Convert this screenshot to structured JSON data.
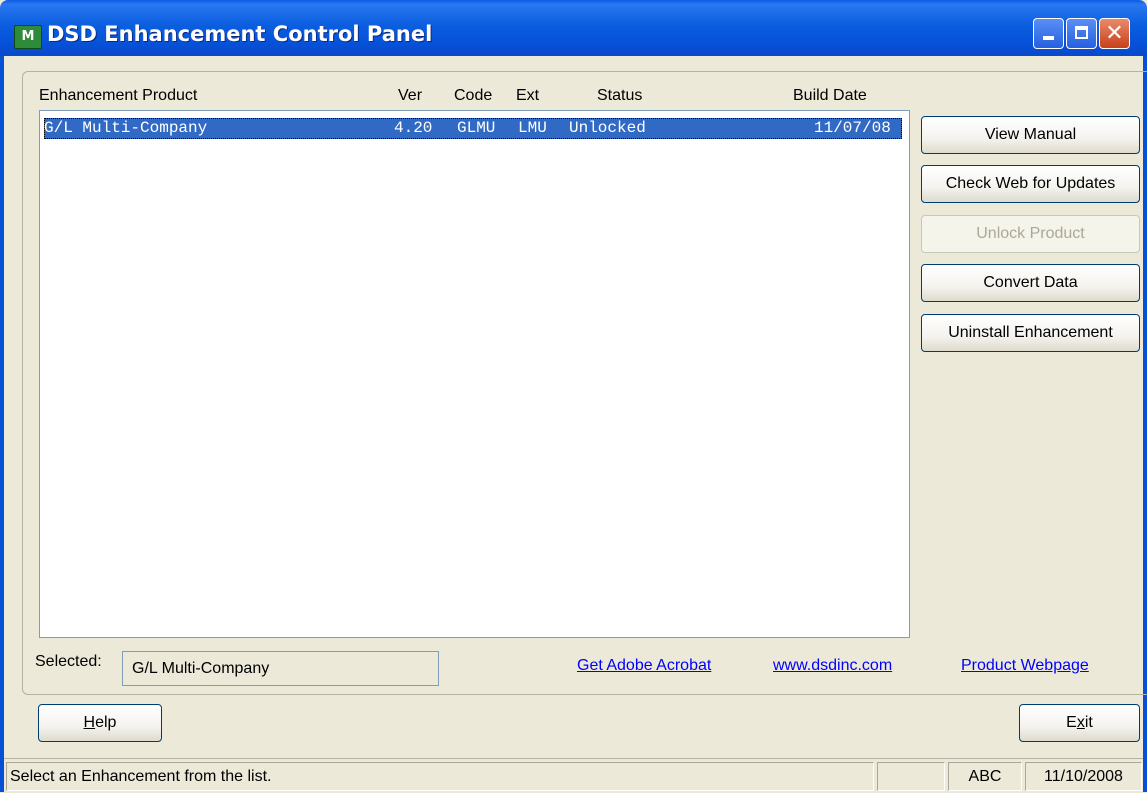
{
  "window": {
    "title": "DSD Enhancement Control Panel",
    "icon_name": "app-m-icon",
    "icon_glyph": "M",
    "close_glyph": "✕"
  },
  "list": {
    "columns": [
      "Enhancement Product",
      "Ver",
      "Code",
      "Ext",
      "Status",
      "Build Date"
    ],
    "rows": [
      {
        "product": "G/L Multi-Company",
        "ver": "4.20",
        "code": "GLMU",
        "ext": "LMU",
        "status": "Unlocked",
        "build_date": "11/07/08",
        "selected": true
      }
    ]
  },
  "actions": {
    "view_manual": "View Manual",
    "check_web": "Check Web for Updates",
    "unlock": "Unlock Product",
    "convert": "Convert Data",
    "uninstall": "Uninstall Enhancement"
  },
  "selected": {
    "label": "Selected:",
    "value": "G/L Multi-Company"
  },
  "links": {
    "acrobat": "Get Adobe Acrobat",
    "website": "www.dsdinc.com",
    "product_page": "Product Webpage"
  },
  "footer": {
    "help_pre": "",
    "help_ul": "H",
    "help_post": "elp",
    "exit_pre": "E",
    "exit_ul": "x",
    "exit_post": "it"
  },
  "status": {
    "message": "Select an Enhancement from the list.",
    "panel2": "",
    "kbd": "ABC",
    "date": "11/10/2008"
  },
  "colors": {
    "title_bar": "#0650d8",
    "selection": "#316ac5",
    "link": "#0000ff",
    "window_bg": "#ece9d8"
  }
}
